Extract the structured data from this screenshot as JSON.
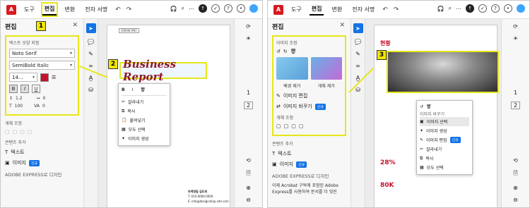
{
  "left": {
    "menu": [
      "도구",
      "편집",
      "변환",
      "전자 서명"
    ],
    "sidebar": {
      "title": "편집",
      "text_format_label": "텍스트 모양 지정",
      "font": "Noto Serif",
      "font_style": "SemiBold Italic",
      "size": "14...",
      "bold": "B",
      "italic": "I",
      "underline": "U",
      "line_spacing": "1.2",
      "char_spacing": "0",
      "scale": "100",
      "baseline": "0",
      "object_label": "개체 조정",
      "add_content_label": "콘텐츠 추가",
      "add_text": "텍스트",
      "add_image": "이미지",
      "new_badge": "신규",
      "express_label": "ADOBE EXPRESS로 디자인"
    },
    "step1": "1",
    "step2": "2",
    "page_text": "Business Report",
    "tag": "[DRAW ME]",
    "context_menu": {
      "format": [
        "B",
        "I"
      ],
      "items": [
        "잘라내기",
        "복사",
        "붙여넣기",
        "모두 선택",
        "이미지 생성"
      ]
    },
    "card_lines": [
      "마케팅팀 김도희",
      "T. 010-0000-0000",
      "E. info@designshop.site.com"
    ],
    "pages": [
      "1",
      "2"
    ]
  },
  "right": {
    "menu": [
      "도구",
      "편집",
      "변환",
      "전자 서명"
    ],
    "sidebar": {
      "title": "편집",
      "image_label": "이미지 조정",
      "bg_remove": "배경 제거",
      "obj_remove": "개체 제거",
      "image_edit": "이미지 편집",
      "image_replace": "이미지 바꾸기",
      "new_badge": "신규",
      "object_label": "개체 조정",
      "add_content_label": "콘텐츠 추가",
      "add_text": "텍스트",
      "add_image": "이미지",
      "express_label": "ADOBE EXPRESS로 디자인",
      "express_text_1": "이제 Acrobat 구독에 포함된 Adobe",
      "express_text_2": "Express를 사용하여 문서를 더 멋진"
    },
    "step3": "3",
    "page_title": "현황",
    "context_menu": {
      "header": "이미지 바꾸기",
      "items": [
        "이미지 선택",
        "이미지 생성",
        "이미지 편집",
        "잘라내기",
        "복사",
        "모두 선택"
      ]
    },
    "stats": [
      "28%",
      "80K"
    ],
    "pages": [
      "1",
      "2"
    ]
  },
  "colors": {
    "highlight": "#e6e61a",
    "accent": "#1473e6",
    "brand_red": "#d71920",
    "title_red": "#8b1a2b"
  }
}
